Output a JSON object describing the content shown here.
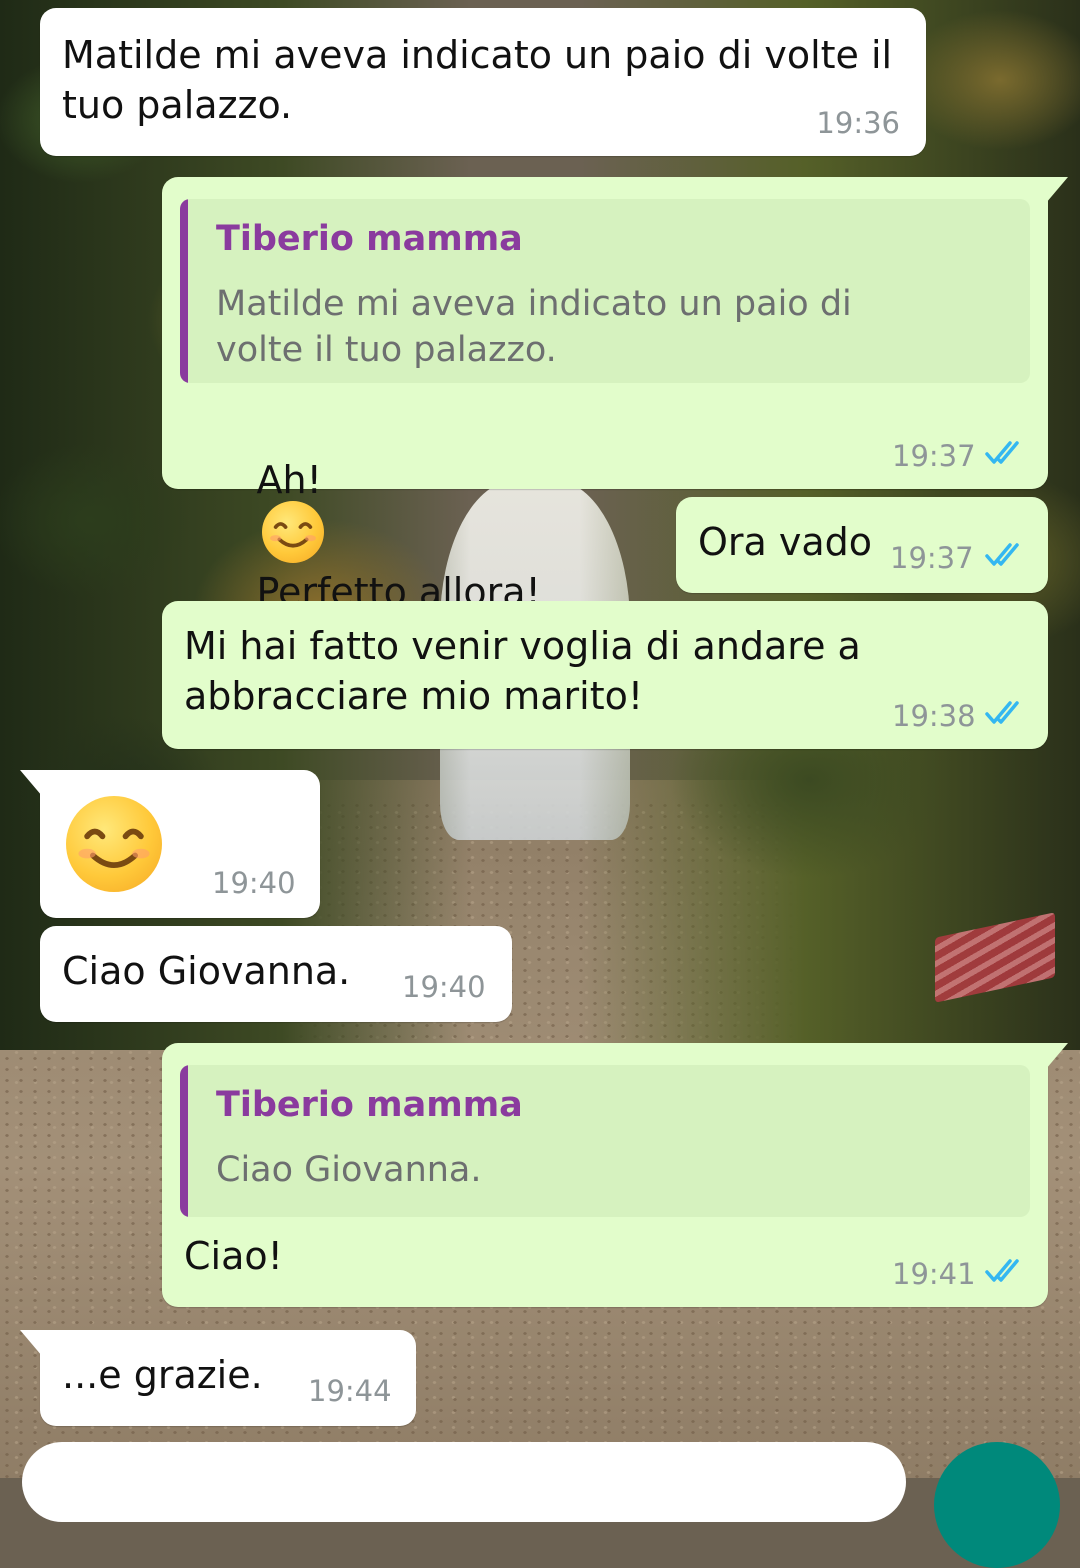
{
  "messages": [
    {
      "text": "Matilde mi aveva indicato un paio di volte il\ntuo palazzo.",
      "time": "19:36"
    },
    {
      "quote_author": "Tiberio mamma",
      "quote_text": "Matilde mi aveva indicato un paio di volte il tuo palazzo.",
      "text_before": "Ah!",
      "emoji": "smiling-face-emoji",
      "text_after": "Perfetto allora!",
      "time": "19:37"
    },
    {
      "text": "Ora vado",
      "time": "19:37"
    },
    {
      "text": "Mi hai fatto venir voglia di andare a\nabbracciare mio marito!",
      "time": "19:38"
    },
    {
      "emoji": "smiling-face-emoji",
      "time": "19:40"
    },
    {
      "text": "Ciao Giovanna.",
      "time": "19:40"
    },
    {
      "quote_author": "Tiberio mamma",
      "quote_text": "Ciao Giovanna.",
      "text": "Ciao!",
      "time": "19:41"
    },
    {
      "text": "...e grazie.",
      "time": "19:44"
    }
  ],
  "colors": {
    "incoming_bubble": "#ffffff",
    "outgoing_bubble": "#e2fdcb",
    "quote_accent": "#8a3b9e",
    "read_ticks": "#34b7f1",
    "send_button": "#00897b"
  }
}
